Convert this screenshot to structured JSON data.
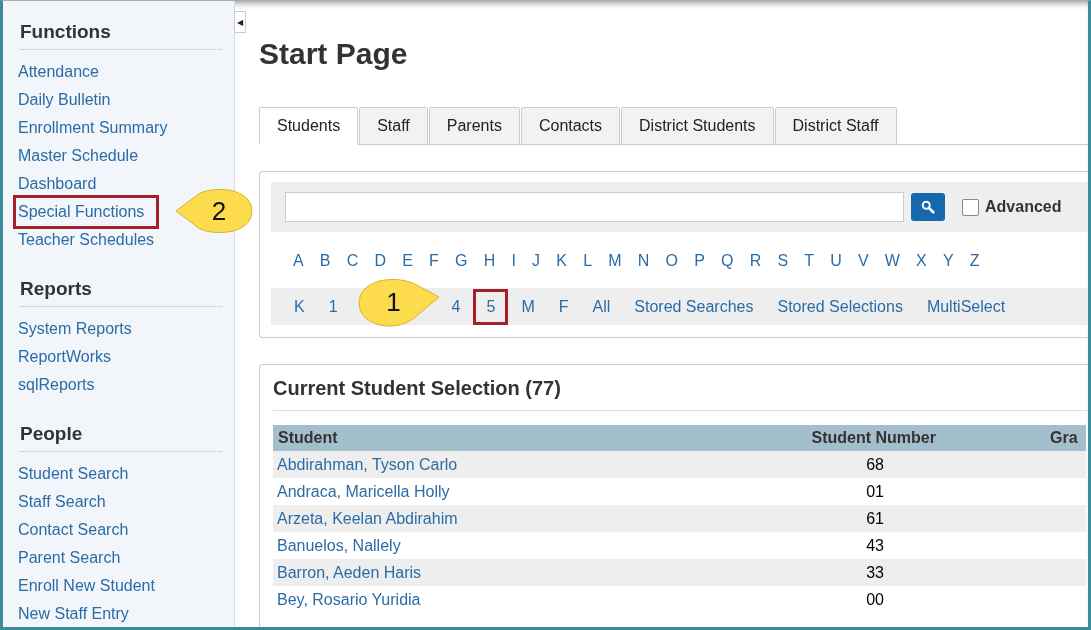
{
  "sidebar": {
    "collapse_button": "◀",
    "sections": [
      {
        "title": "Functions",
        "items": [
          {
            "label": "Attendance",
            "highlighted": false
          },
          {
            "label": "Daily Bulletin",
            "highlighted": false
          },
          {
            "label": "Enrollment Summary",
            "highlighted": false
          },
          {
            "label": "Master Schedule",
            "highlighted": false
          },
          {
            "label": "Dashboard",
            "highlighted": false
          },
          {
            "label": "Special Functions",
            "highlighted": true,
            "callout": "2"
          },
          {
            "label": "Teacher Schedules",
            "highlighted": false
          }
        ]
      },
      {
        "title": "Reports",
        "items": [
          {
            "label": "System Reports",
            "highlighted": false
          },
          {
            "label": "ReportWorks",
            "highlighted": false
          },
          {
            "label": "sqlReports",
            "highlighted": false
          }
        ]
      },
      {
        "title": "People",
        "items": [
          {
            "label": "Student Search",
            "highlighted": false
          },
          {
            "label": "Staff Search",
            "highlighted": false
          },
          {
            "label": "Contact Search",
            "highlighted": false
          },
          {
            "label": "Parent Search",
            "highlighted": false
          },
          {
            "label": "Enroll New Student",
            "highlighted": false
          },
          {
            "label": "New Staff Entry",
            "highlighted": false
          }
        ]
      }
    ]
  },
  "page_title": "Start Page",
  "tabs": [
    {
      "label": "Students",
      "selected": true
    },
    {
      "label": "Staff",
      "selected": false
    },
    {
      "label": "Parents",
      "selected": false
    },
    {
      "label": "Contacts",
      "selected": false
    },
    {
      "label": "District Students",
      "selected": false
    },
    {
      "label": "District Staff",
      "selected": false
    }
  ],
  "search": {
    "advanced": {
      "label": "Advanced",
      "checked": false
    }
  },
  "letters": [
    "A",
    "B",
    "C",
    "D",
    "E",
    "F",
    "G",
    "H",
    "I",
    "J",
    "K",
    "L",
    "M",
    "N",
    "O",
    "P",
    "Q",
    "R",
    "S",
    "T",
    "U",
    "V",
    "W",
    "X",
    "Y",
    "Z"
  ],
  "quick_links": [
    {
      "kind": "link",
      "label": "K",
      "highlighted": false
    },
    {
      "kind": "link",
      "label": "1",
      "highlighted": false
    },
    {
      "kind": "callout",
      "label": "1"
    },
    {
      "kind": "link",
      "label": "4",
      "highlighted": false
    },
    {
      "kind": "link",
      "label": "5",
      "highlighted": true
    },
    {
      "kind": "link",
      "label": "M",
      "highlighted": false
    },
    {
      "kind": "link",
      "label": "F",
      "highlighted": false
    },
    {
      "kind": "link",
      "label": "All",
      "highlighted": false
    },
    {
      "kind": "link",
      "label": "Stored Searches",
      "highlighted": false
    },
    {
      "kind": "link",
      "label": "Stored Selections",
      "highlighted": false
    },
    {
      "kind": "link",
      "label": "MultiSelect",
      "highlighted": false
    }
  ],
  "selection": {
    "title": "Current Student Selection (77)",
    "columns": [
      "Student",
      "Student Number",
      "Gra"
    ],
    "rows": [
      {
        "student": "Abdirahman, Tyson Carlo",
        "number": "68"
      },
      {
        "student": "Andraca, Maricella Holly",
        "number": "01"
      },
      {
        "student": "Arzeta, Keelan Abdirahim",
        "number": "61"
      },
      {
        "student": "Banuelos, Nallely",
        "number": "43"
      },
      {
        "student": "Barron, Aeden Haris",
        "number": "33"
      },
      {
        "student": "Bey, Rosario Yuridia",
        "number": "00"
      }
    ]
  }
}
